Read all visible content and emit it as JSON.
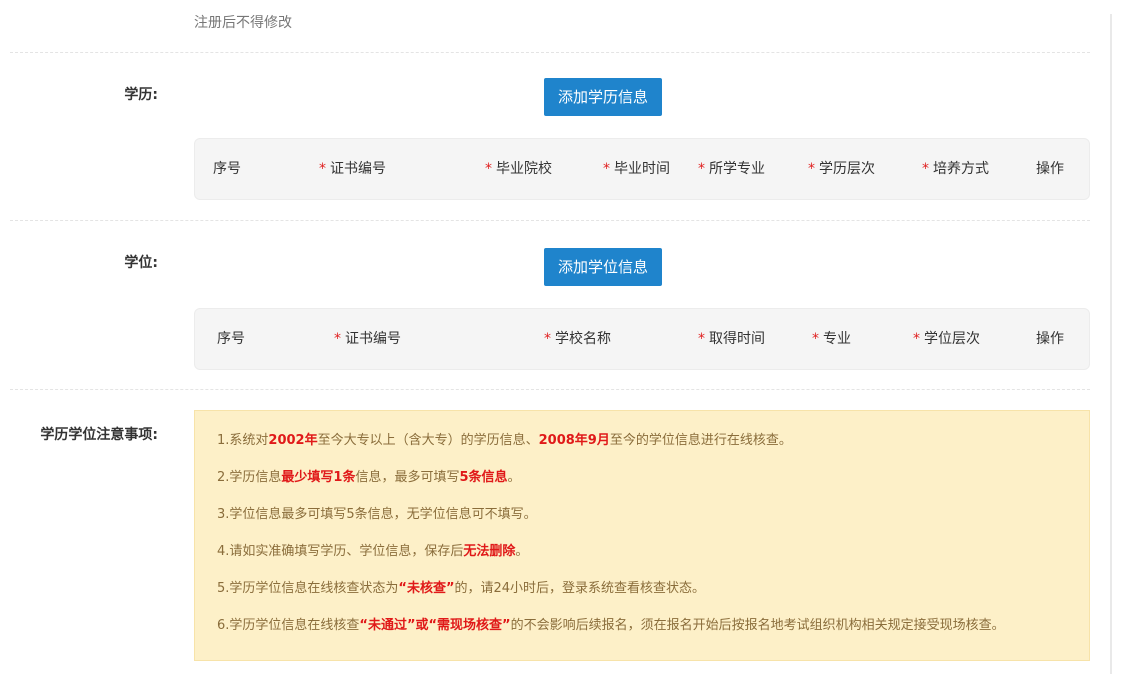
{
  "form": {
    "hint": "注册后不得修改",
    "education_label": "学历:",
    "add_education_button": "添加学历信息",
    "degree_label": "学位:",
    "add_degree_button": "添加学位信息",
    "notes_label": "学历学位注意事项:"
  },
  "education_table": {
    "columns": [
      {
        "label": "序号",
        "required": false
      },
      {
        "label": "证书编号",
        "required": true
      },
      {
        "label": "毕业院校",
        "required": true
      },
      {
        "label": "毕业时间",
        "required": true
      },
      {
        "label": "所学专业",
        "required": true
      },
      {
        "label": "学历层次",
        "required": true
      },
      {
        "label": "培养方式",
        "required": true
      },
      {
        "label": "操作",
        "required": false
      }
    ]
  },
  "degree_table": {
    "columns": [
      {
        "label": "序号",
        "required": false
      },
      {
        "label": "证书编号",
        "required": true
      },
      {
        "label": "学校名称",
        "required": true
      },
      {
        "label": "取得时间",
        "required": true
      },
      {
        "label": "专业",
        "required": true
      },
      {
        "label": "学位层次",
        "required": true
      },
      {
        "label": "操作",
        "required": false
      }
    ]
  },
  "required_mark": "*",
  "notes": [
    {
      "parts": [
        {
          "t": "1.系统对"
        },
        {
          "t": "2002年",
          "em": true
        },
        {
          "t": "至今大专以上（含大专）的学历信息、"
        },
        {
          "t": "2008年9月",
          "em": true
        },
        {
          "t": "至今的学位信息进行在线核查。"
        }
      ]
    },
    {
      "parts": [
        {
          "t": "2.学历信息"
        },
        {
          "t": "最少填写1条",
          "em": true
        },
        {
          "t": "信息，最多可填写"
        },
        {
          "t": "5条信息",
          "em": true
        },
        {
          "t": "。"
        }
      ]
    },
    {
      "parts": [
        {
          "t": "3.学位信息最多可填写5条信息，无学位信息可不填写。"
        }
      ]
    },
    {
      "parts": [
        {
          "t": "4.请如实准确填写学历、学位信息，保存后"
        },
        {
          "t": "无法删除",
          "em": true
        },
        {
          "t": "。"
        }
      ]
    },
    {
      "parts": [
        {
          "t": "5.学历学位信息在线核查状态为"
        },
        {
          "t": "“未核查”",
          "em": true
        },
        {
          "t": "的，请24小时后，登录系统查看核查状态。"
        }
      ]
    },
    {
      "parts": [
        {
          "t": "6.学历学位信息在线核查"
        },
        {
          "t": "“未通过”或“需现场核查”",
          "em": true
        },
        {
          "t": "的不会影响后续报名，须在报名开始后按报名地考试组织机构相关规定接受现场核查。"
        }
      ]
    }
  ],
  "colors": {
    "button": "#1f84cc",
    "required": "#e02020",
    "emphasis": "#e01919",
    "notes_bg": "#fdf0c8"
  }
}
